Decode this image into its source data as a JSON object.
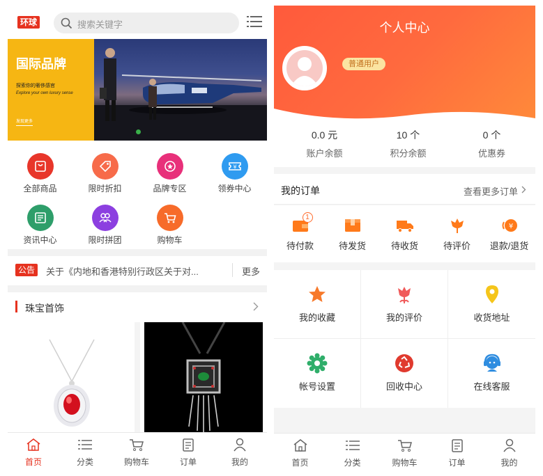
{
  "left": {
    "logo": "环球",
    "search": {
      "placeholder": "搜索关键字"
    },
    "banner": {
      "title": "国际品牌",
      "subtitle": "探索你的奢侈感官",
      "subtitle_en": "Explore your own luxury sense",
      "more": "发现更多"
    },
    "categories": [
      {
        "label": "全部商品",
        "icon": "bag-icon",
        "color": "#e8362a"
      },
      {
        "label": "限时折扣",
        "icon": "tag-icon",
        "color": "#f76b4a"
      },
      {
        "label": "品牌专区",
        "icon": "medal-icon",
        "color": "#e8307a"
      },
      {
        "label": "领券中心",
        "icon": "coupon-icon",
        "color": "#2f9bf0"
      },
      {
        "label": "资讯中心",
        "icon": "news-icon",
        "color": "#2e9e6a"
      },
      {
        "label": "限时拼团",
        "icon": "group-icon",
        "color": "#8c3fe0"
      },
      {
        "label": "购物车",
        "icon": "cart-icon",
        "color": "#f76b2a"
      }
    ],
    "notice": {
      "tag": "公告",
      "text": "关于《内地和香港特别行政区关于对...",
      "more": "更多"
    },
    "section": {
      "title": "珠宝首饰"
    },
    "tabs": [
      {
        "label": "首页",
        "icon": "home-icon",
        "active": true
      },
      {
        "label": "分类",
        "icon": "list-icon"
      },
      {
        "label": "购物车",
        "icon": "cart-icon"
      },
      {
        "label": "订单",
        "icon": "order-icon"
      },
      {
        "label": "我的",
        "icon": "user-icon"
      }
    ]
  },
  "right": {
    "title": "个人中心",
    "user_badge": "普通用户",
    "stats": [
      {
        "value": "0.0 元",
        "label": "账户余额"
      },
      {
        "value": "10 个",
        "label": "积分余额"
      },
      {
        "value": "0 个",
        "label": "优惠券"
      }
    ],
    "orders": {
      "title": "我的订单",
      "more": "查看更多订单",
      "items": [
        {
          "label": "待付款",
          "icon": "wallet-icon",
          "count": "1"
        },
        {
          "label": "待发货",
          "icon": "box-icon"
        },
        {
          "label": "待收货",
          "icon": "truck-icon"
        },
        {
          "label": "待评价",
          "icon": "flower-icon"
        },
        {
          "label": "退款/退货",
          "icon": "refund-icon"
        }
      ]
    },
    "services": [
      {
        "label": "我的收藏",
        "icon": "star-icon",
        "color": "#f7792a"
      },
      {
        "label": "我的评价",
        "icon": "tulip-icon",
        "color": "#f05a5a"
      },
      {
        "label": "收货地址",
        "icon": "location-icon",
        "color": "#f5c51a"
      },
      {
        "label": "帐号设置",
        "icon": "settings-icon",
        "color": "#2fae6a"
      },
      {
        "label": "回收中心",
        "icon": "recycle-icon",
        "color": "#e03a2e"
      },
      {
        "label": "在线客服",
        "icon": "support-icon",
        "color": "#2f8de0"
      }
    ],
    "tabs": [
      {
        "label": "首页",
        "icon": "home-icon"
      },
      {
        "label": "分类",
        "icon": "list-icon"
      },
      {
        "label": "购物车",
        "icon": "cart-icon"
      },
      {
        "label": "订单",
        "icon": "order-icon"
      },
      {
        "label": "我的",
        "icon": "user-icon"
      }
    ]
  }
}
